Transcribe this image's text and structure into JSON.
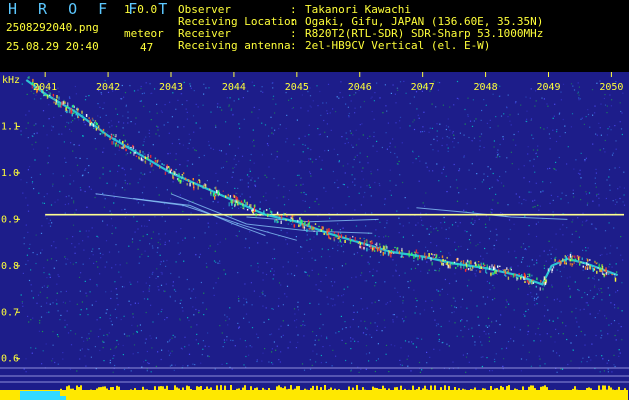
{
  "app": {
    "name": "H R O F F T",
    "version": "1.0.0"
  },
  "file": {
    "name": "2508292040.png",
    "datetime": "25.08.29 20:40"
  },
  "meteor": {
    "label": "meteor",
    "count": "47"
  },
  "info": [
    {
      "label": "Observer",
      "sep": ":",
      "value": "Takanori Kawachi"
    },
    {
      "label": "Receiving Location",
      "sep": ":",
      "value": "Ogaki, Gifu, JAPAN (136.60E, 35.35N)"
    },
    {
      "label": "Receiver",
      "sep": ":",
      "value": "R820T2(RTL-SDR) SDR-Sharp 53.1000MHz"
    },
    {
      "label": "Receiving antenna",
      "sep": ":",
      "value": "2el-HB9CV Vertical (el. E-W)"
    }
  ],
  "colors": {
    "background": "#1d1d8a",
    "text": "#ffff3a",
    "title": "#5cc8ff",
    "beacon": "#ffff90",
    "ticks": "#ffff3a"
  },
  "chart_data": {
    "type": "heatmap",
    "ylabel": "kHz",
    "x_ticks": [
      "2041",
      "2042",
      "2043",
      "2044",
      "2045",
      "2046",
      "2047",
      "2048",
      "2049",
      "2050"
    ],
    "y_ticks": [
      "1.1",
      "1.0",
      "0.9",
      "0.8",
      "0.7",
      "0.6"
    ],
    "x_range": [
      2040.6,
      2050.2
    ],
    "y_range": [
      0.58,
      1.2
    ],
    "beacon_khz": 0.91,
    "echo_trace": {
      "x": [
        2040.7,
        2041.0,
        2041.5,
        2042.0,
        2042.5,
        2043.0,
        2043.5,
        2044.0,
        2044.5,
        2045.0,
        2045.5,
        2046.0,
        2046.5,
        2047.0,
        2047.5,
        2048.0,
        2048.5,
        2048.9,
        2049.05,
        2049.3,
        2049.6,
        2050.0,
        2050.1
      ],
      "y": [
        1.2,
        1.17,
        1.13,
        1.08,
        1.04,
        1.0,
        0.97,
        0.94,
        0.91,
        0.895,
        0.87,
        0.85,
        0.83,
        0.82,
        0.805,
        0.795,
        0.78,
        0.76,
        0.8,
        0.815,
        0.805,
        0.785,
        0.78
      ]
    },
    "crossing_traces": [
      {
        "x": [
          2041.8,
          2043.2,
          2044.2,
          2045.0
        ],
        "y": [
          0.955,
          0.93,
          0.885,
          0.855
        ]
      },
      {
        "x": [
          2042.4,
          2043.3,
          2044.0,
          2044.5
        ],
        "y": [
          0.945,
          0.93,
          0.89,
          0.865
        ]
      },
      {
        "x": [
          2043.0,
          2044.2,
          2045.2,
          2046.2
        ],
        "y": [
          0.955,
          0.89,
          0.875,
          0.87
        ]
      },
      {
        "x": [
          2044.2,
          2045.2,
          2046.3
        ],
        "y": [
          0.905,
          0.895,
          0.9
        ]
      },
      {
        "x": [
          2046.9,
          2047.7,
          2048.4,
          2049.3
        ],
        "y": [
          0.925,
          0.915,
          0.905,
          0.9
        ]
      }
    ]
  }
}
